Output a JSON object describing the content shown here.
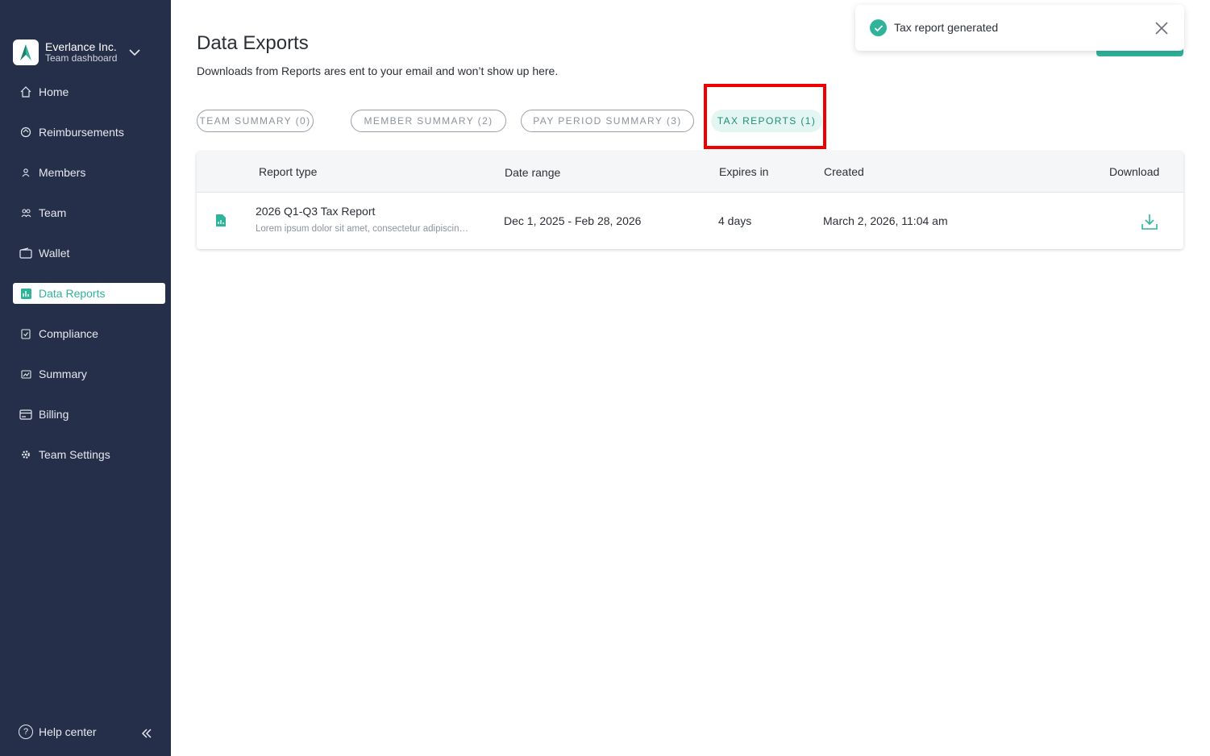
{
  "org": {
    "name": "Everlance Inc.",
    "subtitle": "Team dashboard"
  },
  "sidebar": {
    "items": [
      {
        "label": "Home",
        "icon": "home-icon"
      },
      {
        "label": "Reimbursements",
        "icon": "reimbursements-icon"
      },
      {
        "label": "Members",
        "icon": "member-icon"
      },
      {
        "label": "Team",
        "icon": "team-icon"
      },
      {
        "label": "Wallet",
        "icon": "wallet-icon"
      },
      {
        "label": "Data Reports",
        "icon": "data-reports-icon",
        "active": true
      },
      {
        "label": "Compliance",
        "icon": "compliance-icon"
      },
      {
        "label": "Summary",
        "icon": "summary-icon"
      },
      {
        "label": "Billing",
        "icon": "billing-icon"
      },
      {
        "label": "Team Settings",
        "icon": "gear-icon"
      }
    ],
    "help_label": "Help center"
  },
  "page": {
    "title": "Data Exports",
    "subtitle": "Downloads from Reports ares ent to your email and won’t show up here."
  },
  "tabs": [
    {
      "label": "TEAM SUMMARY (0)"
    },
    {
      "label": "MEMBER SUMMARY (2)"
    },
    {
      "label": "PAY PERIOD SUMMARY (3)"
    },
    {
      "label": "TAX REPORTS (1)",
      "active": true
    }
  ],
  "table": {
    "headers": [
      "Report type",
      "Date range",
      "Expires in",
      "Created",
      "Download"
    ],
    "rows": [
      {
        "name": "2026 Q1-Q3 Tax Report",
        "description": "Lorem ipsum dolor sit amet, consectetur adipiscing elit",
        "date_range": "Dec 1, 2025 - Feb 28, 2026",
        "expires": "4 days",
        "created": "March 2, 2026, 11:04 am"
      }
    ]
  },
  "toast": {
    "message": "Tax report generated"
  },
  "colors": {
    "sidebar_bg": "#262f4a",
    "accent": "#2fb49a",
    "highlight": "#ee0000"
  }
}
